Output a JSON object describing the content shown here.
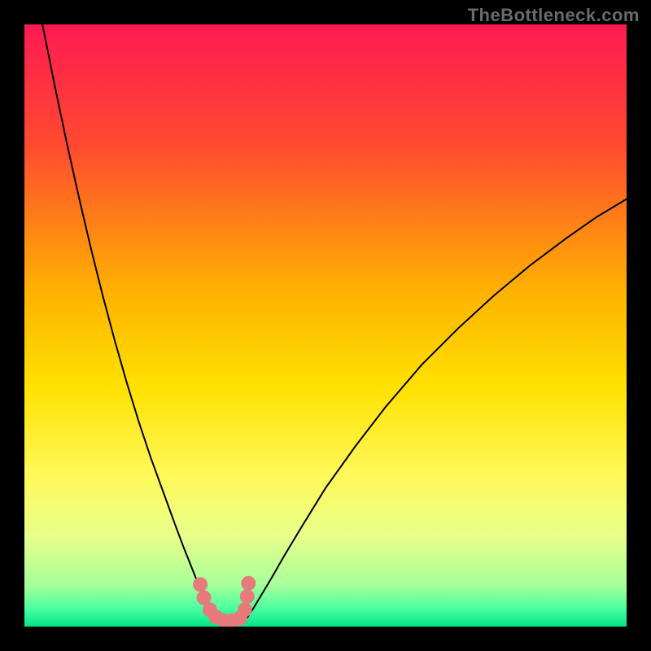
{
  "watermark": "TheBottleneck.com",
  "chart_data": {
    "type": "line",
    "title": "",
    "xlabel": "",
    "ylabel": "",
    "xlim": [
      0,
      100
    ],
    "ylim": [
      0,
      100
    ],
    "background_gradient": {
      "stops": [
        {
          "offset": 0.0,
          "color": "#ff1a52"
        },
        {
          "offset": 0.2,
          "color": "#ff4a2f"
        },
        {
          "offset": 0.45,
          "color": "#ffb400"
        },
        {
          "offset": 0.6,
          "color": "#ffe100"
        },
        {
          "offset": 0.75,
          "color": "#fff95a"
        },
        {
          "offset": 0.85,
          "color": "#e8ff8a"
        },
        {
          "offset": 0.93,
          "color": "#a8ff9a"
        },
        {
          "offset": 0.97,
          "color": "#4bffa0"
        },
        {
          "offset": 1.0,
          "color": "#00e58a"
        }
      ]
    },
    "series": [
      {
        "name": "left-branch",
        "color": "#000000",
        "width": 2,
        "x": [
          3,
          5,
          7,
          9,
          11,
          13,
          15,
          17,
          19,
          21,
          23,
          25,
          26.5,
          27.5,
          28.5,
          29.5,
          30.5,
          31.5,
          32.5
        ],
        "y": [
          100,
          90,
          80.5,
          71.5,
          63,
          55,
          47.5,
          40.5,
          34,
          28,
          22.5,
          17,
          13,
          10.5,
          8,
          6,
          4,
          2.5,
          1.5
        ]
      },
      {
        "name": "right-branch",
        "color": "#000000",
        "width": 2,
        "x": [
          37,
          38,
          39.5,
          41,
          43,
          46,
          50,
          55,
          60,
          66,
          72,
          78,
          84,
          90,
          95,
          100
        ],
        "y": [
          1.5,
          3,
          5.5,
          8,
          11.5,
          16.5,
          23,
          30,
          36.5,
          43.5,
          49.5,
          55,
          60,
          64.5,
          68,
          71
        ]
      },
      {
        "name": "highlight-dots",
        "color": "#e57b7b",
        "type": "scatter",
        "marker_size": 9,
        "x": [
          29.2,
          29.8,
          30.8,
          31.8,
          33.2,
          34.6,
          35.8,
          36.6,
          37.0,
          37.2
        ],
        "y": [
          7.0,
          4.8,
          2.8,
          1.6,
          1.0,
          1.0,
          1.4,
          2.8,
          5.0,
          7.2
        ]
      }
    ]
  }
}
